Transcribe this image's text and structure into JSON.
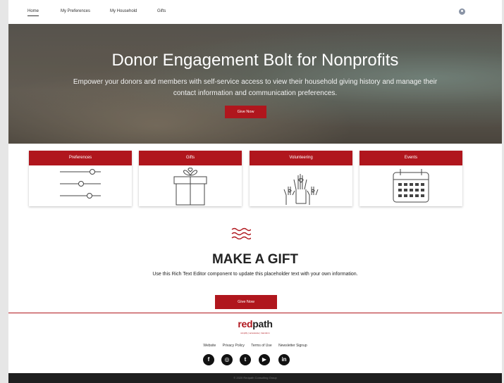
{
  "nav": {
    "items": [
      {
        "label": "Home",
        "active": true
      },
      {
        "label": "My Preferences"
      },
      {
        "label": "My Household"
      },
      {
        "label": "Gifts"
      }
    ]
  },
  "hero": {
    "title": "Donor Engagement Bolt for Nonprofits",
    "subtitle": "Empower your donors and members with self-service access to view their household giving history and manage their contact information and communication preferences.",
    "button_label": "Give Now"
  },
  "cards": [
    {
      "title": "Preferences",
      "icon": "sliders-icon"
    },
    {
      "title": "Gifts",
      "icon": "gift-icon"
    },
    {
      "title": "Volunteering",
      "icon": "raised-hands-icon"
    },
    {
      "title": "Events",
      "icon": "calendar-icon"
    }
  ],
  "gift": {
    "title": "MAKE A GIFT",
    "text": "Use this Rich Text Editor component to update this placeholder text with your own information.",
    "button_label": "Give Now"
  },
  "footer": {
    "logo_part1": "red",
    "logo_part2": "path",
    "tagline": "simplify | accelerate | transform",
    "links": [
      "Website",
      "Privacy Policy",
      "Terms of Use",
      "Newsletter Signup"
    ],
    "socials": [
      "facebook-icon",
      "instagram-icon",
      "twitter-icon",
      "youtube-icon",
      "linkedin-icon"
    ],
    "copyright": "© 2020 Redpath Consulting Group"
  },
  "colors": {
    "brand_red": "#b0161d",
    "footer_dark": "#1f1f1f"
  }
}
